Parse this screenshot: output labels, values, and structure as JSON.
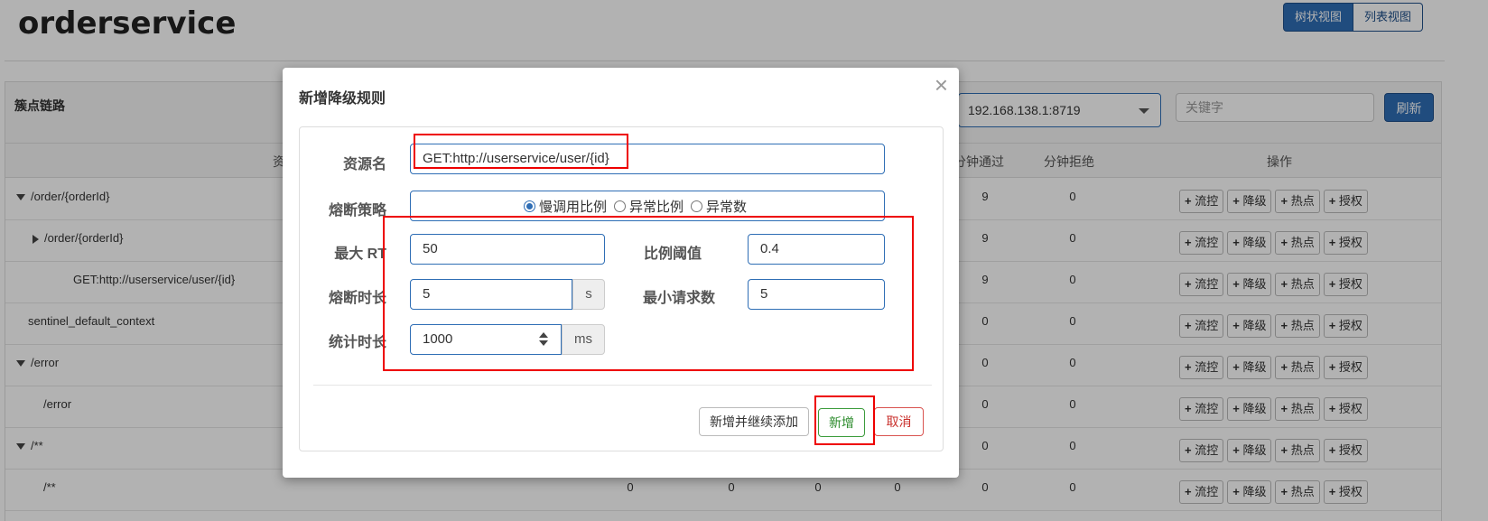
{
  "header": {
    "title": "orderservice",
    "view_tree": "树状视图",
    "view_list": "列表视图"
  },
  "panel": {
    "title": "簇点链路",
    "machine": "192.168.138.1:8719",
    "keyword_placeholder": "关键字",
    "refresh": "刷新"
  },
  "table": {
    "columns": {
      "resource": "资",
      "pass_per_min": "分钟通过",
      "block_per_min": "分钟拒绝",
      "ops": "操作"
    },
    "op_labels": {
      "flow": "流控",
      "degrade": "降级",
      "hot": "热点",
      "auth": "授权"
    },
    "rows": [
      {
        "name": "/order/{orderId}",
        "pass": "9",
        "block": "0"
      },
      {
        "name": "/order/{orderId}",
        "pass": "9",
        "block": "0"
      },
      {
        "name": "GET:http://userservice/user/{id}",
        "pass": "9",
        "block": "0"
      },
      {
        "name": "sentinel_default_context",
        "pass": "0",
        "block": "0"
      },
      {
        "name": "/error",
        "pass": "0",
        "block": "0"
      },
      {
        "name": "/error",
        "pass": "0",
        "block": "0"
      },
      {
        "name": "/**",
        "pass": "0",
        "block": "0"
      },
      {
        "name": "/**",
        "c1": "0",
        "c2": "0",
        "c3": "0",
        "c4": "0",
        "pass": "0",
        "block": "0"
      }
    ]
  },
  "modal": {
    "title": "新增降级规则",
    "close": "×",
    "resource_label": "资源名",
    "resource_value": "GET:http://userservice/user/{id}",
    "strategy_label": "熔断策略",
    "strategy_options": [
      "慢调用比例",
      "异常比例",
      "异常数"
    ],
    "max_rt_label": "最大 RT",
    "max_rt_value": "50",
    "ratio_label": "比例阈值",
    "ratio_value": "0.4",
    "duration_label": "熔断时长",
    "duration_value": "5",
    "duration_unit": "s",
    "min_request_label": "最小请求数",
    "min_request_value": "5",
    "stat_label": "统计时长",
    "stat_value": "1000",
    "stat_unit": "ms",
    "btn_continue": "新增并继续添加",
    "btn_add": "新增",
    "btn_cancel": "取消"
  }
}
